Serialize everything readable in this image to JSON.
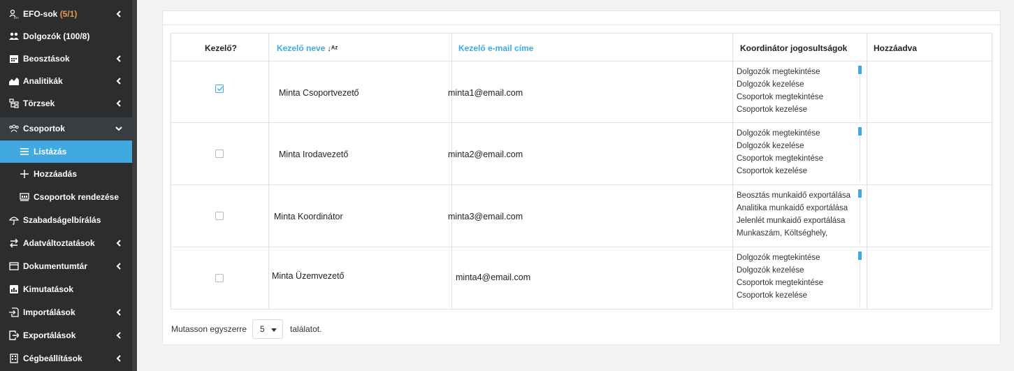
{
  "sidebar": {
    "efo_label": "EFO-sok",
    "efo_count": "(5/1)",
    "dolgozok": "Dolgozók (100/8)",
    "beosztasok": "Beosztások",
    "analitikak": "Analitikák",
    "torzsek": "Törzsek",
    "csoportok": "Csoportok",
    "listazas": "Listázás",
    "hozzaadas": "Hozzáadás",
    "csoportok_rendezese": "Csoportok rendezése",
    "szabadsag": "Szabadságelbírálás",
    "adatvaltoztatasok": "Adatváltoztatások",
    "dokumentumtar": "Dokumentumtár",
    "kimutatasok": "Kimutatások",
    "importalasok": "Importálások",
    "exportalasok": "Exportálások",
    "cegbeallitasok": "Cégbeállítások"
  },
  "table": {
    "headers": {
      "kezelo": "Kezelő?",
      "name": "Kezelő neve",
      "email": "Kezelő e-mail címe",
      "perms": "Koordinátor jogosultságok",
      "added": "Hozzáadva"
    },
    "rows": [
      {
        "checked": true,
        "name": "Minta Csoportvezető",
        "email": "minta1@email.com",
        "perms": [
          "Dolgozók megtekintése",
          "Dolgozók kezelése",
          "Csoportok megtekintése",
          "Csoportok kezelése"
        ],
        "added": ""
      },
      {
        "checked": false,
        "name": "Minta Irodavezető",
        "email": "minta2@email.com",
        "perms": [
          "Dolgozók megtekintése",
          "Dolgozók kezelése",
          "Csoportok megtekintése",
          "Csoportok kezelése"
        ],
        "added": ""
      },
      {
        "checked": false,
        "name": "Minta Koordinátor",
        "email": "minta3@email.com",
        "perms": [
          "Beosztás munkaidő exportálása",
          "Analitika munkaidő exportálása",
          "Jelenlét munkaidő exportálása",
          "Munkaszám, Költséghely,"
        ],
        "added": ""
      },
      {
        "checked": false,
        "name": "Minta Üzemvezető",
        "email": "minta4@email.com",
        "perms": [
          "Dolgozók megtekintése",
          "Dolgozók kezelése",
          "Csoportok megtekintése",
          "Csoportok kezelése"
        ],
        "added": ""
      }
    ]
  },
  "pager": {
    "prefix": "Mutasson egyszerre",
    "page_size": "5",
    "suffix": "találatot."
  },
  "colors": {
    "accent": "#3fa9e0",
    "sidebar_bg": "#2b2d2f",
    "highlight": "#f2994a"
  }
}
